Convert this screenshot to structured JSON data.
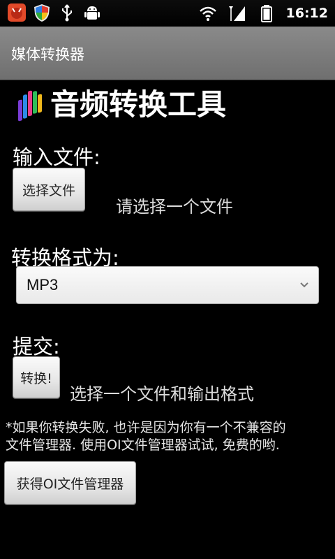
{
  "status_bar": {
    "time": "16:12",
    "left_icons": [
      "app-notification-icon",
      "shield-icon",
      "usb-icon",
      "android-debug-icon"
    ],
    "right_icons": [
      "wifi-icon",
      "signal-icon",
      "battery-icon"
    ]
  },
  "title_bar": {
    "title": "媒体转换器"
  },
  "app": {
    "heading": "音频转换工具",
    "input_label": "输入文件:",
    "choose_button": "选择文件",
    "choose_hint": "请选择一个文件",
    "format_label": "转换格式为:",
    "format_selected": "MP3",
    "submit_label": "提交:",
    "convert_button": "转换!",
    "submit_hint": "选择一个文件和输出格式",
    "note_line1": "*如果你转换失败, 也许是因为你有一个不兼容的",
    "note_line2": "文件管理器. 使用OI文件管理器试试, 免费的哟.",
    "get_oi_button": "获得OI文件管理器"
  },
  "colors": {
    "background": "#000000",
    "title_bar": "#7a7a7a",
    "button_face": "#e6e6e6",
    "text": "#ffffff"
  }
}
